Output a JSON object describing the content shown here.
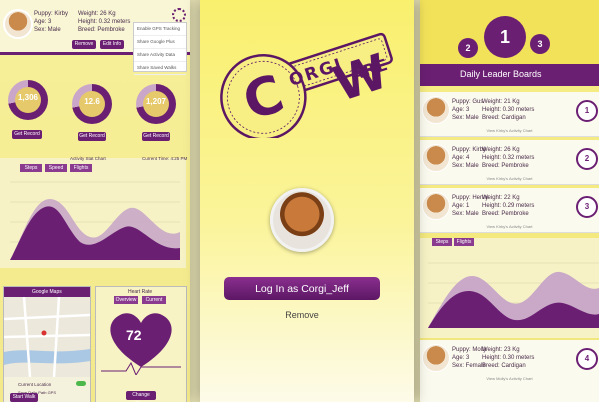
{
  "left": {
    "profile": {
      "puppy": "Puppy: Kirby",
      "age": "Age: 3",
      "sex": "Sex: Male",
      "weight": "Weight: 26 Kg",
      "height": "Height: 0.32 meters",
      "breed": "Breed: Pembroke"
    },
    "profile_buttons": [
      "Remove",
      "Edit Info"
    ],
    "settings_menu": [
      "Enable GPS Tracking",
      "Share Google Plus",
      "Share Activity Data",
      "Share Saved Walks"
    ],
    "stats": [
      {
        "value": "1,306",
        "label": "Get Record"
      },
      {
        "value": "12.6",
        "label": "Get Record"
      },
      {
        "value": "1,207",
        "label": "Get Record"
      }
    ],
    "chart_title": "Activity Stat Chart",
    "current_time": "Current Time: 4:25 PM",
    "chart_tabs": [
      "Steps",
      "Speed",
      "Flights"
    ],
    "map_title": "Google Maps",
    "current_location": "Current Location",
    "save_walk_note": "Save Daily Path GPS",
    "start_walk": "Start Walk",
    "heart_title": "Heart Rate",
    "heart_tabs": [
      "Overview",
      "Current"
    ],
    "heart_value": "72",
    "heart_button": "Change Chart"
  },
  "middle": {
    "logo_top": "ORGI",
    "logo_bottom": "ARE",
    "logo_c": "C",
    "logo_w": "W",
    "login_label": "Log In as Corgi_Jeff",
    "remove_label": "Remove"
  },
  "right": {
    "title": "Daily Leader Boards",
    "medals": [
      "1",
      "2",
      "3"
    ],
    "cards": [
      {
        "puppy": "Puppy: Gus",
        "age": "Age: 3",
        "sex": "Sex: Male",
        "weight": "Weight: 21 Kg",
        "height": "Height: 0.30 meters",
        "breed": "Breed: Cardigan",
        "rank": "1",
        "link": "View Kirby's Activity Chart"
      },
      {
        "puppy": "Puppy: Kirby",
        "age": "Age: 4",
        "sex": "Sex: Male",
        "weight": "Weight: 26 Kg",
        "height": "Height: 0.32 meters",
        "breed": "Breed: Pembroke",
        "rank": "2",
        "link": "View Kirby's Activity Chart"
      },
      {
        "puppy": "Puppy: Henry",
        "age": "Age: 1",
        "sex": "Sex: Male",
        "weight": "Weight: 22 Kg",
        "height": "Height: 0.29 meters",
        "breed": "Breed: Pembroke",
        "rank": "3",
        "link": "View Kirby's Activity Chart"
      },
      {
        "puppy": "Puppy: Molly",
        "age": "Age: 3",
        "sex": "Sex: Female",
        "weight": "Weight: 23 Kg",
        "height": "Height: 0.30 meters",
        "breed": "Breed: Cardigan",
        "rank": "4",
        "link": "View Molly's Activity Chart"
      }
    ],
    "chart_tabs": [
      "Steps",
      "Flights"
    ]
  },
  "colors": {
    "accent": "#6b1f73",
    "yellow": "#f9f06e",
    "button": "#7a2a80"
  }
}
